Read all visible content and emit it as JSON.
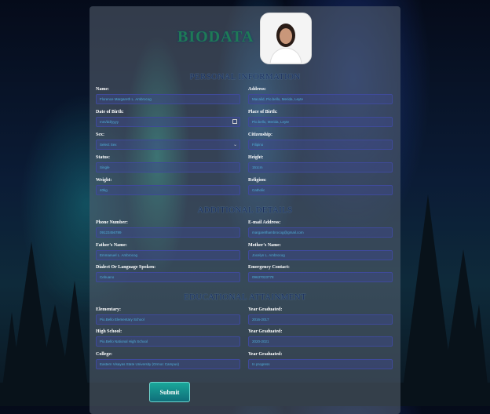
{
  "title": "BIODATA",
  "sections": {
    "personal": "PERSONAL INFORMATION",
    "additional": "ADDITIONAL DETAILS",
    "education": "EDUCATIONAL ATTAINMENT"
  },
  "personal": {
    "name_label": "Name:",
    "name_value": "Florence Margareth L. Ambrocog",
    "address_label": "Address:",
    "address_value": "Macalid, Pio.bello, Merida, Leyte",
    "dob_label": "Date of Birth:",
    "dob_value": "mm/dd/yyyy",
    "pob_label": "Place of Birth:",
    "pob_value": "Pio.bello, Merida, Leyte",
    "sex_label": "Sex:",
    "sex_value": "Select Sex",
    "citizenship_label": "Citizenship:",
    "citizenship_value": "Filipino",
    "status_label": "Status:",
    "status_value": "Single",
    "height_label": "Height:",
    "height_value": "151cm",
    "weight_label": "Weight:",
    "weight_value": "40kg",
    "religion_label": "Religion:",
    "religion_value": "Catholic"
  },
  "additional": {
    "phone_label": "Phone Number:",
    "phone_value": "09123456789",
    "email_label": "E-mail Address:",
    "email_value": "margarethambrocog@gmail.com",
    "father_label": "Father's Name:",
    "father_value": "Emmanuel L. Ambrocog",
    "mother_label": "Mother's Name:",
    "mother_value": "Jocelyn L. Ambrocog",
    "dialect_label": "Dialect Or Language Spoken:",
    "dialect_value": "Cebuano",
    "emergency_label": "Emergency Contact:",
    "emergency_value": "09637023778"
  },
  "education": {
    "elementary_label": "Elementary:",
    "elementary_value": "Pio.Bello Elementary School",
    "elementary_year_label": "Year Graduated:",
    "elementary_year_value": "2016-2017",
    "high_label": "High School:",
    "high_value": "Pio.Bello National High School",
    "high_year_label": "Year Graduated:",
    "high_year_value": "2020-2021",
    "college_label": "College:",
    "college_value": "Eastern Visayas State University (Ormoc Campus)",
    "college_year_label": "Year Graduated:",
    "college_year_value": "In progress"
  },
  "submit_label": "Submit"
}
